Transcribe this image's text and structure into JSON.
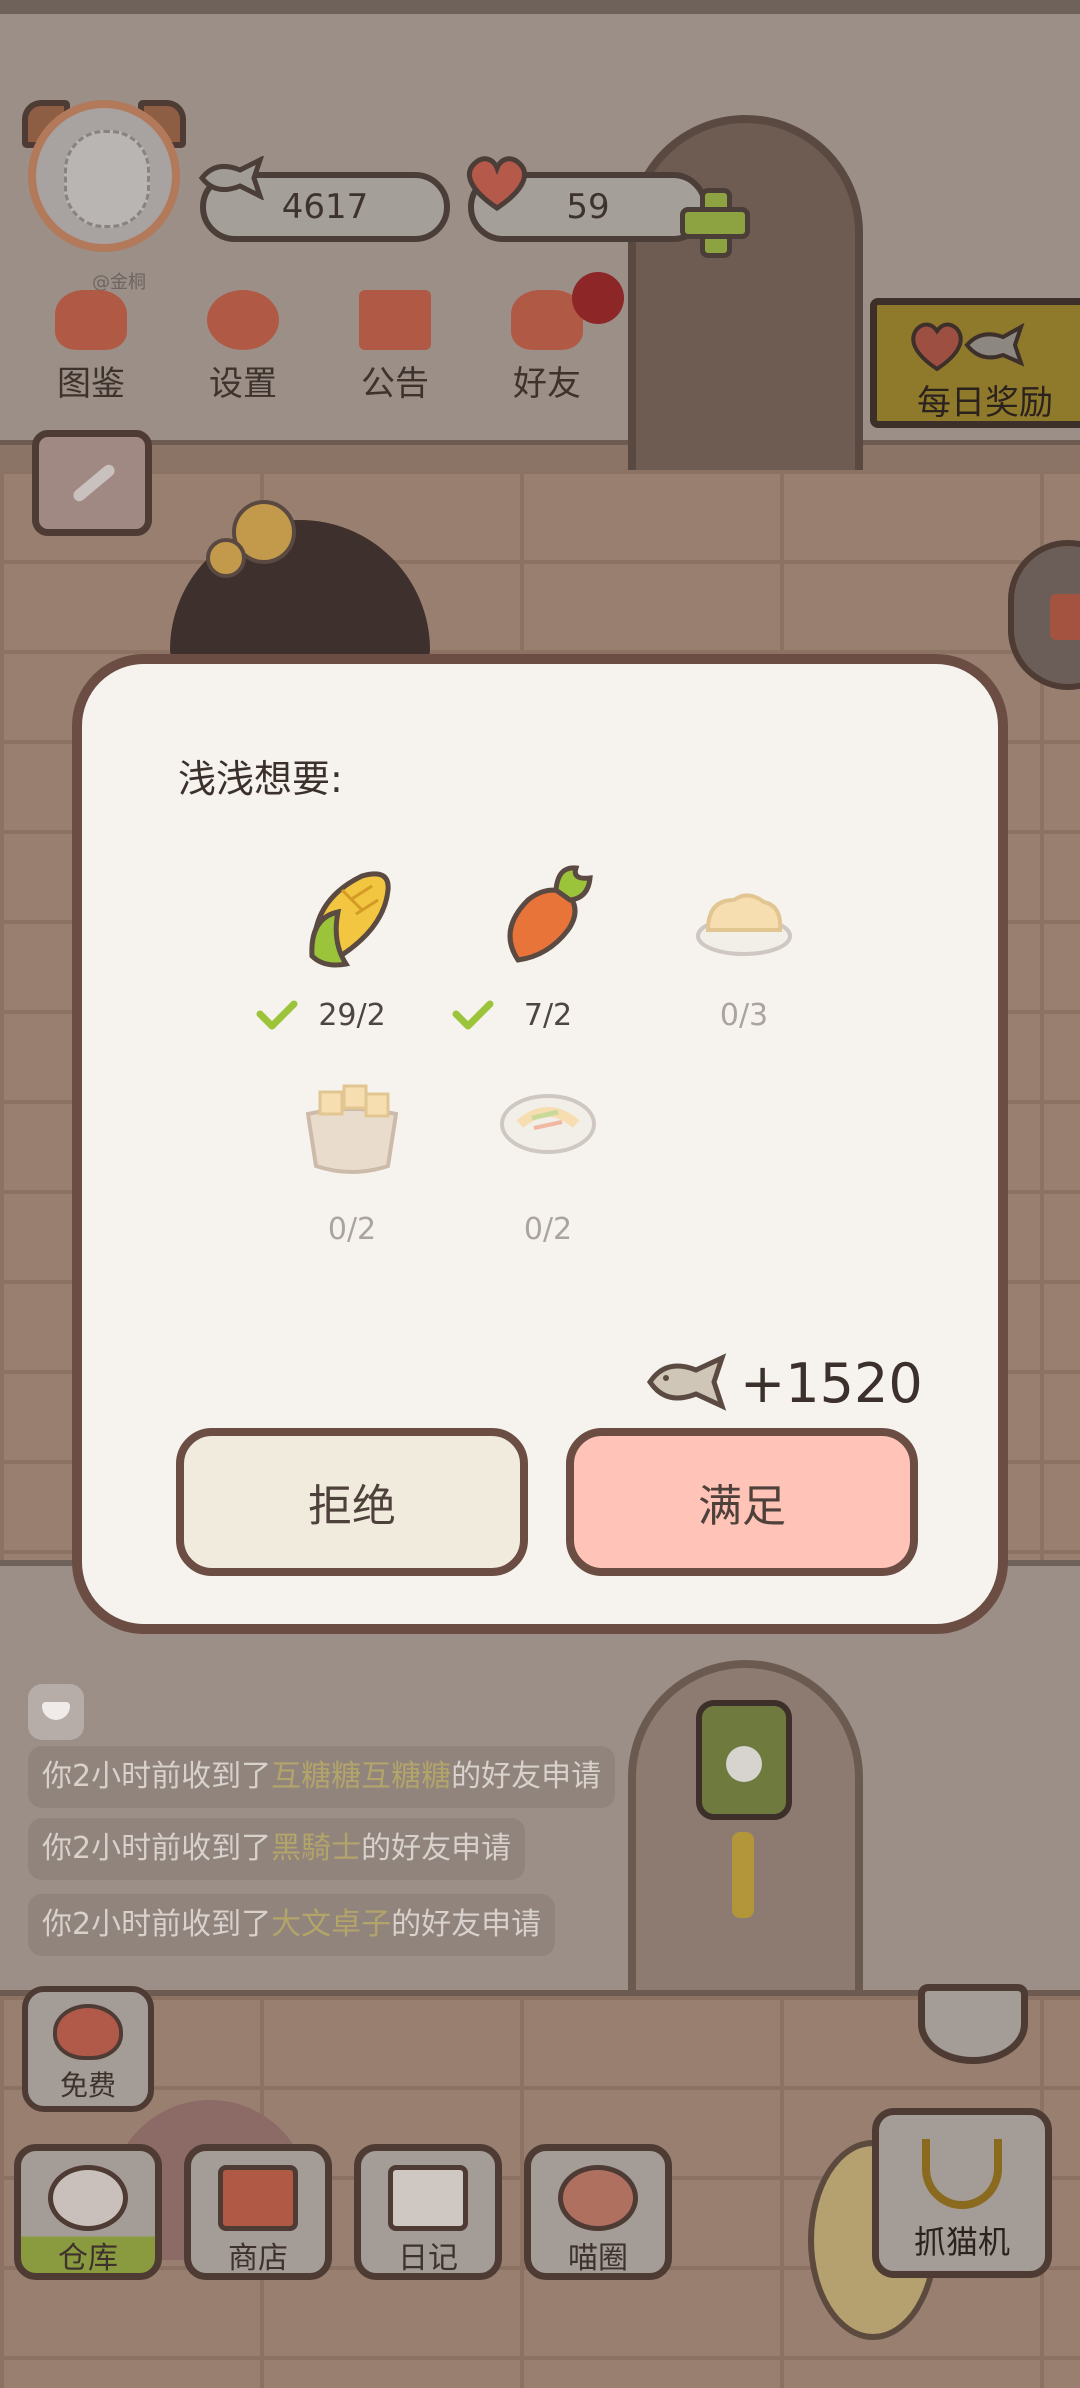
{
  "hud": {
    "fish_count": "4617",
    "heart_count": "59",
    "avatar_tag": "@金桐"
  },
  "menu": [
    {
      "label": "图鉴",
      "icon": "cat-head-icon"
    },
    {
      "label": "设置",
      "icon": "gear-icon"
    },
    {
      "label": "公告",
      "icon": "gift-icon"
    },
    {
      "label": "好友",
      "icon": "friends-icon"
    }
  ],
  "daily_reward": {
    "label": "每日奖励"
  },
  "dialog": {
    "title": "浅浅想要:",
    "items": [
      {
        "name": "corn",
        "icon": "corn-icon",
        "count": "29/2",
        "done": true
      },
      {
        "name": "carrot",
        "icon": "carrot-icon",
        "count": "7/2",
        "done": true
      },
      {
        "name": "rice",
        "icon": "rice-icon",
        "count": "0/3",
        "done": false
      },
      {
        "name": "tofu-bowl",
        "icon": "tofu-bowl-icon",
        "count": "0/2",
        "done": false
      },
      {
        "name": "noodle-plate",
        "icon": "noodle-plate-icon",
        "count": "0/2",
        "done": false
      }
    ],
    "reward": "+1520",
    "reject_label": "拒绝",
    "accept_label": "满足"
  },
  "messages": [
    {
      "prefix": "你2小时前收到了",
      "name": "互糖糖互糖糖",
      "suffix": "的好友申请"
    },
    {
      "prefix": "你2小时前收到了",
      "name": "黑騎士",
      "suffix": "的好友申请"
    },
    {
      "prefix": "你2小时前收到了",
      "name": "大文卓子",
      "suffix": "的好友申请"
    }
  ],
  "free_button": {
    "label": "免费"
  },
  "dock": [
    {
      "label": "仓库",
      "icon": "warehouse-icon"
    },
    {
      "label": "商店",
      "icon": "shop-icon"
    },
    {
      "label": "日记",
      "icon": "diary-icon"
    },
    {
      "label": "喵圈",
      "icon": "cat-planet-icon"
    }
  ],
  "claw_machine": {
    "label": "抓猫机"
  },
  "colors": {
    "accept": "#ffc3b7",
    "reject": "#f1ebde",
    "check": "#9cc43a",
    "dialog_border": "#6b4d44"
  }
}
